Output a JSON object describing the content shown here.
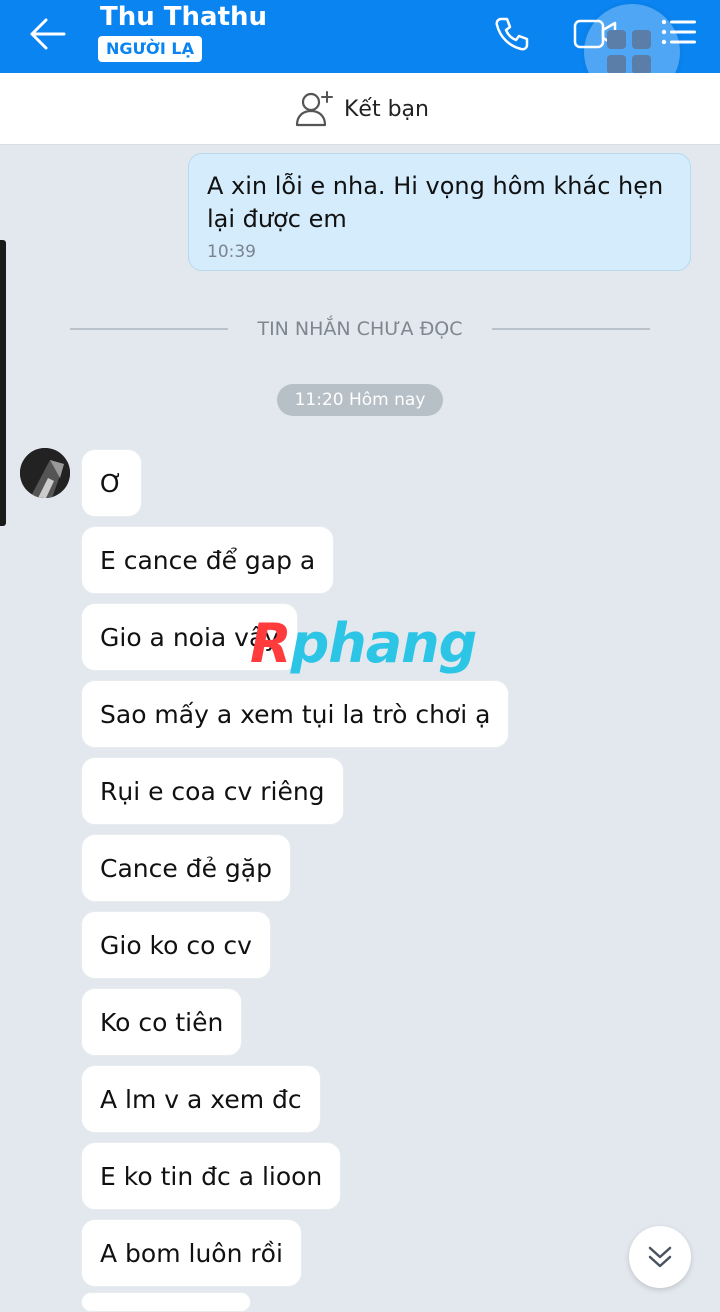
{
  "header": {
    "contact_name": "Thu Thathu",
    "badge": "NGƯỜI LẠ",
    "icons": [
      "back-arrow-icon",
      "phone-icon",
      "video-call-icon",
      "menu-icon",
      "apps-grid-icon"
    ],
    "bg_color": "#0a84f0"
  },
  "friend_bar": {
    "label": "Kết bạn",
    "icon": "add-friend-icon"
  },
  "outgoing_message": {
    "text": "A xin lỗi e nha. Hi vọng hôm khác hẹn lại được em",
    "time": "10:39"
  },
  "unread_divider": "TIN NHẮN CHƯA ĐỌC",
  "time_chip": "11:20 Hôm nay",
  "incoming_messages": [
    "Ơ",
    "E cance để gap a",
    "Gio a noia vậy",
    "Sao mấy a xem tụi la trò chơi ạ",
    "Rụi e coa cv riêng",
    "Cance đẻ gặp",
    "Gio ko co cv",
    "Ko co tiên",
    "A lm v a xem đc",
    "E ko tin đc a lioon",
    "A bom luôn rồi"
  ],
  "watermark": {
    "first": "R",
    "rest": "phang"
  }
}
